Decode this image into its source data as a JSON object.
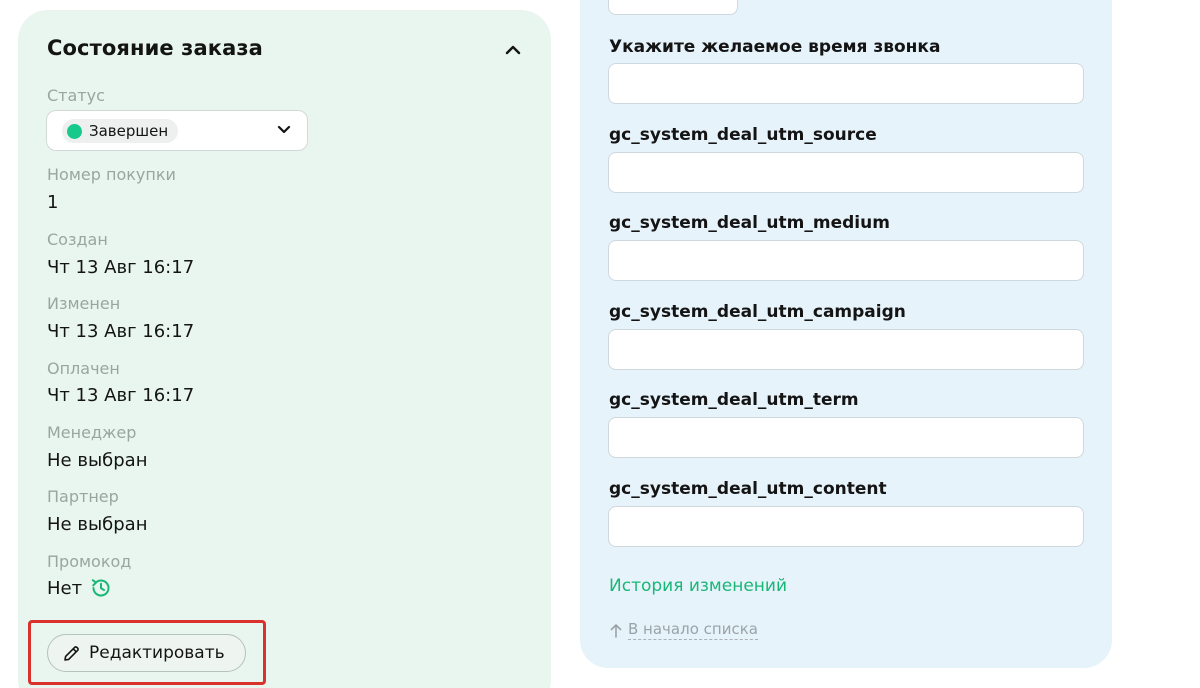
{
  "order_state": {
    "title": "Состояние заказа",
    "status_label": "Статус",
    "status_value": "Завершен",
    "status_color": "#17c98a",
    "purchase_number_label": "Номер покупки",
    "purchase_number_value": "1",
    "created_label": "Создан",
    "created_value": "Чт 13 Авг 16:17",
    "modified_label": "Изменен",
    "modified_value": "Чт 13 Авг 16:17",
    "paid_label": "Оплачен",
    "paid_value": "Чт 13 Авг 16:17",
    "manager_label": "Менеджер",
    "manager_value": "Не выбран",
    "partner_label": "Партнер",
    "partner_value": "Не выбран",
    "promo_label": "Промокод",
    "promo_value": "Нет",
    "edit_button_label": "Редактировать"
  },
  "form": {
    "fields": [
      {
        "label": "Укажите желаемое время звонка",
        "value": ""
      },
      {
        "label": "gc_system_deal_utm_source",
        "value": ""
      },
      {
        "label": "gc_system_deal_utm_medium",
        "value": ""
      },
      {
        "label": "gc_system_deal_utm_campaign",
        "value": ""
      },
      {
        "label": "gc_system_deal_utm_term",
        "value": ""
      },
      {
        "label": "gc_system_deal_utm_content",
        "value": ""
      }
    ],
    "history_link": "История изменений",
    "back_to_top": "В начало списка"
  },
  "colors": {
    "accent_green": "#19b776",
    "highlight_red": "#d9322d"
  }
}
